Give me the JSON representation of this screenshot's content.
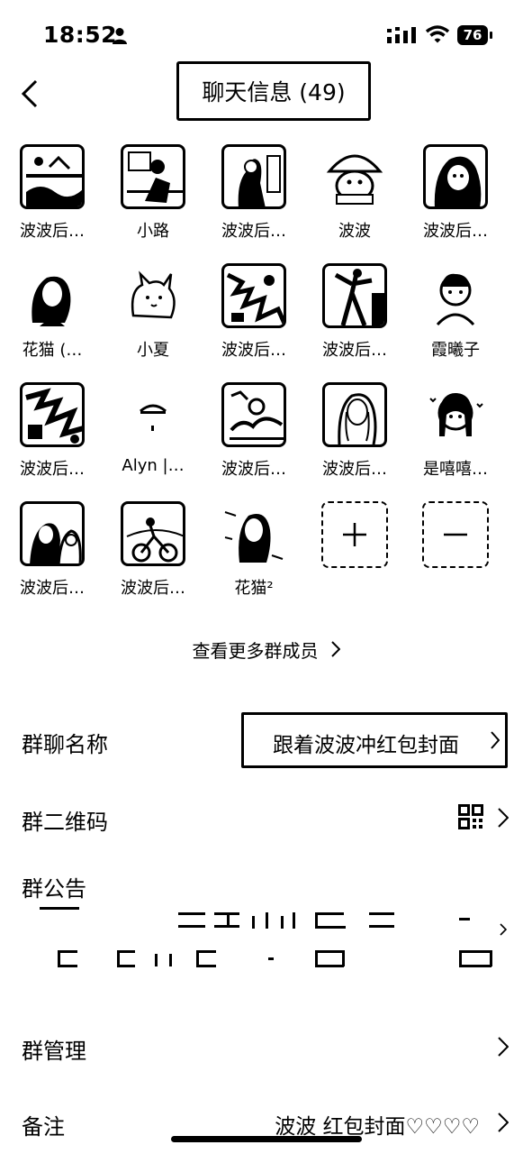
{
  "status_bar": {
    "time": "18:52",
    "battery": "76",
    "icons": [
      "person-icon",
      "signal-icon",
      "wifi-icon"
    ]
  },
  "nav": {
    "back_icon": "chevron-left-icon",
    "title": "聊天信息 (49)"
  },
  "members": [
    {
      "name": "波波后…",
      "avatar": "landscape"
    },
    {
      "name": "小路",
      "avatar": "boy-desk"
    },
    {
      "name": "波波后…",
      "avatar": "girl-photo"
    },
    {
      "name": "波波",
      "avatar": "cartoon-hat"
    },
    {
      "name": "波波后…",
      "avatar": "girl-dark"
    },
    {
      "name": "花猫 (…",
      "avatar": "woman-portrait"
    },
    {
      "name": "小夏",
      "avatar": "cartoon-cat"
    },
    {
      "name": "波波后…",
      "avatar": "noise"
    },
    {
      "name": "波波后…",
      "avatar": "dancer"
    },
    {
      "name": "霞曦子",
      "avatar": "girl-cartoon"
    },
    {
      "name": "波波后…",
      "avatar": "noise2"
    },
    {
      "name": "Alyn |…",
      "avatar": "tiny"
    },
    {
      "name": "波波后…",
      "avatar": "scene"
    },
    {
      "name": "波波后…",
      "avatar": "long-hair"
    },
    {
      "name": "是嘻嘻…",
      "avatar": "cute-girl"
    },
    {
      "name": "波波后…",
      "avatar": "couple"
    },
    {
      "name": "波波后…",
      "avatar": "bikes"
    },
    {
      "name": "花猫²",
      "avatar": "woman-sticker"
    }
  ],
  "member_actions": {
    "add_icon": "plus-icon",
    "remove_icon": "minus-icon"
  },
  "more_members": "查看更多群成员",
  "settings": {
    "group_name_label": "群聊名称",
    "group_name_value": "跟着波波冲红包封面",
    "qr_label": "群二维码",
    "notice_label": "群公告",
    "manage_label": "群管理",
    "remark_label": "备注",
    "remark_value": "波波 红包封面♡♡♡♡"
  }
}
